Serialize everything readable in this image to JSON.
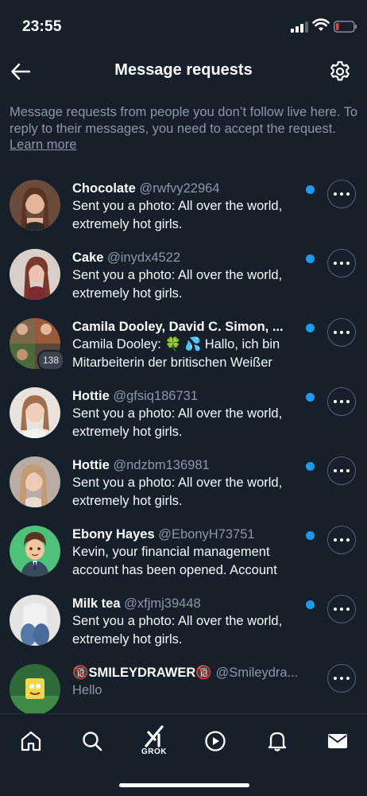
{
  "status_bar": {
    "time": "23:55"
  },
  "header": {
    "title": "Message requests"
  },
  "intro": {
    "text": "Message requests from people you don’t follow live here. To reply to their messages, you need to accept the request.",
    "link": "Learn more"
  },
  "requests": [
    {
      "name": "Chocolate",
      "handle": "@rwfvy22964",
      "preview": "Sent you a photo: All over the world, extremely hot girls.",
      "unread": true
    },
    {
      "name": "Cake",
      "handle": "@inydx4522",
      "preview": "Sent you a photo: All over the world, extremely hot girls.",
      "unread": true
    },
    {
      "name": "Camila Dooley, David C. Simon, ...",
      "handle": "",
      "preview": "Camila Dooley: 🍀 💦 Hallo, ich bin Mitarbeiterin der britischen Weißer",
      "unread": true,
      "badge": "138"
    },
    {
      "name": "Hottie",
      "handle": "@gfsiq186731",
      "preview": "Sent you a photo: All over the world, extremely hot girls.",
      "unread": true
    },
    {
      "name": "Hottie",
      "handle": "@ndzbm136981",
      "preview": "Sent you a photo: All over the world, extremely hot girls.",
      "unread": true
    },
    {
      "name": "Ebony Hayes",
      "handle": "@EbonyH73751",
      "preview": "Kevin, your financial management account has been opened. Account",
      "unread": true
    },
    {
      "name": "Milk tea",
      "handle": "@xfjmj39448",
      "preview": "Sent you a photo: All over the world, extremely hot girls.",
      "unread": true
    },
    {
      "name": "🔞SMILEYDRAWER🔞",
      "handle": "@Smileydra...",
      "preview": "Hello",
      "unread": false
    }
  ],
  "nav": {
    "grok_label": "GROK"
  },
  "colors": {
    "background": "#15202b",
    "accent": "#1d9bf0",
    "muted": "#8b98a5"
  }
}
